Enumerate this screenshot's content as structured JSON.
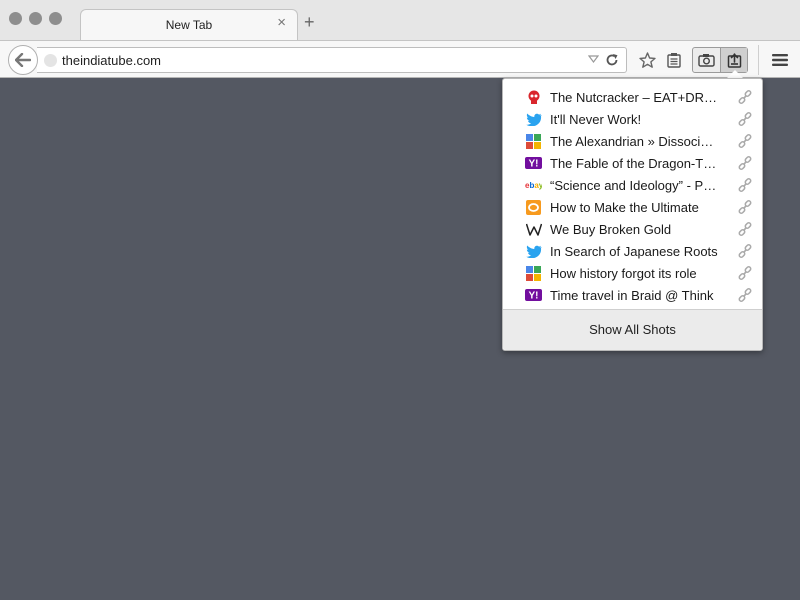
{
  "tab": {
    "title": "New Tab"
  },
  "toolbar": {
    "url": "theindiatube.com"
  },
  "panel": {
    "items": [
      {
        "title": "The Nutcracker – EAT+DRINK",
        "favicon": "red-skull-icon"
      },
      {
        "title": "It'll Never Work!",
        "favicon": "twitter-bird-icon"
      },
      {
        "title": "The Alexandrian » Dissociated",
        "favicon": "google-apps-icon"
      },
      {
        "title": "The Fable of the Dragon-Tyrant",
        "favicon": "yahoo-icon"
      },
      {
        "title": "“Science and Ideology” - Paul",
        "favicon": "ebay-icon"
      },
      {
        "title": "How to Make the Ultimate",
        "favicon": "orange-rss-icon"
      },
      {
        "title": "We Buy Broken Gold",
        "favicon": "wikipedia-icon"
      },
      {
        "title": "In Search of Japanese Roots",
        "favicon": "twitter-bird-icon"
      },
      {
        "title": "How history forgot its role",
        "favicon": "google-apps-icon"
      },
      {
        "title": "Time travel in Braid @ Think",
        "favicon": "yahoo-icon"
      }
    ],
    "footer_label": "Show All Shots"
  }
}
